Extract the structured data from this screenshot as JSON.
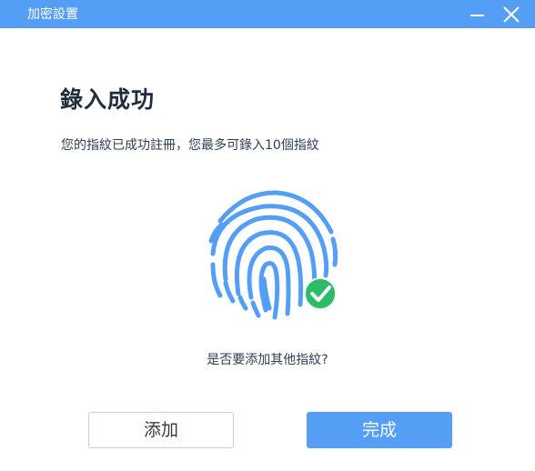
{
  "window": {
    "title": "加密設置"
  },
  "content": {
    "heading": "錄入成功",
    "description": "您的指紋已成功註冊，您最多可錄入10個指紋",
    "question": "是否要添加其他指紋?"
  },
  "icons": {
    "fingerprint": "fingerprint-icon",
    "success": "check-circle-icon",
    "minimize": "minimize-icon",
    "close": "close-icon"
  },
  "buttons": {
    "add_label": "添加",
    "done_label": "完成"
  },
  "colors": {
    "accent": "#559ef5",
    "fingerprint": "#559ef5",
    "success": "#2dbb67",
    "text_dark": "#1f2d3d"
  }
}
